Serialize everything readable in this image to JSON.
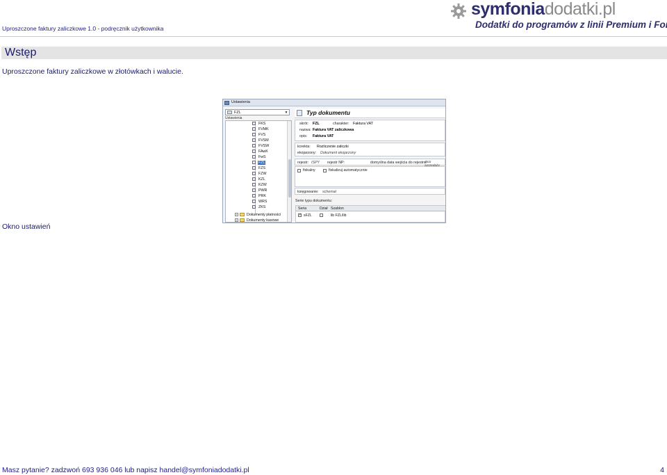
{
  "header": {
    "doc_title": "Uproszczone faktury zaliczkowe 1.0  - podręcznik użytkownika",
    "logo": {
      "word_part1": "symfonia",
      "word_part2": "dodatki.pl",
      "tagline": "Dodatki do programów z linii Premium i Forte"
    }
  },
  "section": {
    "title": "Wstęp",
    "intro": "Uproszczone faktury zaliczkowe w złotówkach i walucie.",
    "caption": "Okno ustawień"
  },
  "screenshot": {
    "window_title": "Ustawienia",
    "combo_value": "FZL",
    "tree_caption": "Ustawienia",
    "tree_items": [
      "FKS",
      "FVMK",
      "FVS",
      "FVSM",
      "FVSW",
      "FAwK",
      "FwS",
      "FZL",
      "FZS",
      "FZW",
      "KZL",
      "KZW",
      "PWR",
      "PRK",
      "WRS",
      "ZKS"
    ],
    "selected_item": "FZL",
    "tree_nodes": [
      "Dokumenty płatności",
      "Dokumenty kasowe"
    ],
    "panel_title": "Typ dokumentu",
    "fields": {
      "skrot_label": "skrót:",
      "skrot_value": "FZL",
      "charakter_label": "charakter:",
      "charakter_value": "Faktura VAT",
      "nazwa_label": "nazwa:",
      "nazwa_value": "Faktura VAT zaliczkowa",
      "opis_label": "opis:",
      "opis_value": "Faktura VAT",
      "korekta_label": "korekta:",
      "korekta_value": "Rozliczenie zaliczki",
      "ekojarzony_label": "ekojarzony:",
      "ekojarzony_value": "Dokument ekojarzony",
      "rejestr_label": "rejestr:",
      "rejestr_value": "ISPY",
      "rejestr_np_label": "rejestr NP:",
      "data_label": "domyślna data wejścia do rejestru:",
      "data_value": "data sprzedaży",
      "fiskalny_label": "fiskalny",
      "fiskalizuj_label": "fiskalizuj automatycznie",
      "ksiegowanie_label": "księgowanie:",
      "ksiegowanie_value": "schemat"
    },
    "series_caption": "Serie typu dokumentu:",
    "table": {
      "headers": [
        "Seria",
        "Dział",
        "Szablon"
      ],
      "row": [
        "sFZL",
        "",
        "lib FZL/lib"
      ]
    }
  },
  "footer": {
    "question": "Masz pytanie?",
    "call_text": "zadzwoń",
    "phone": "693 936 046",
    "or_text": "lub napisz",
    "email": "handel@symfoniadodatki.pl"
  },
  "page_number": "4",
  "colors": {
    "text": "#1a1a6a",
    "section_bar": "#e4e4e4",
    "logo_dark": "#2d2d70",
    "logo_gray": "#8a8a8a"
  }
}
